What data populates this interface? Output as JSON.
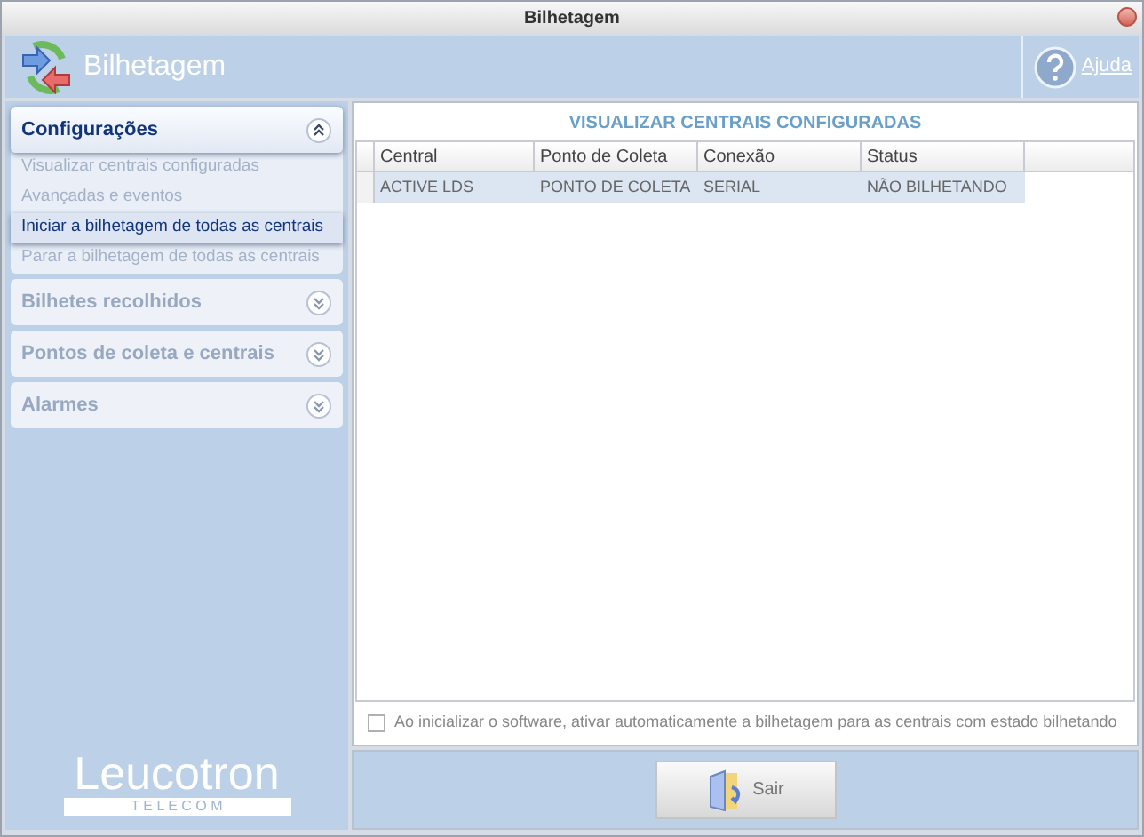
{
  "window": {
    "title": "Bilhetagem"
  },
  "header": {
    "title": "Bilhetagem",
    "help": "Ajuda"
  },
  "sidebar": {
    "sections": [
      {
        "title": "Configurações",
        "expanded": true,
        "items": [
          {
            "label": "Visualizar centrais configuradas",
            "selected": false
          },
          {
            "label": "Avançadas e eventos",
            "selected": false
          },
          {
            "label": "Iniciar a bilhetagem de todas as centrais",
            "selected": true
          },
          {
            "label": "Parar a bilhetagem de todas as centrais",
            "selected": false
          }
        ]
      },
      {
        "title": "Bilhetes recolhidos",
        "expanded": false
      },
      {
        "title": "Pontos de coleta e centrais",
        "expanded": false
      },
      {
        "title": "Alarmes",
        "expanded": false
      }
    ],
    "logo": {
      "name": "Leucotron",
      "tagline": "T E L E C O M"
    }
  },
  "content": {
    "title": "VISUALIZAR CENTRAIS CONFIGURADAS",
    "table": {
      "columns": [
        "Central",
        "Ponto de Coleta",
        "Conexão",
        "Status"
      ],
      "rows": [
        {
          "selected": true,
          "cells": [
            "ACTIVE LDS",
            "PONTO DE COLETA",
            "SERIAL",
            "NÃO BILHETANDO"
          ]
        }
      ]
    },
    "checkbox": {
      "label": "Ao inicializar o software, ativar automaticamente a bilhetagem para as centrais com estado bilhetando",
      "checked": false
    }
  },
  "buttons": [
    {
      "label": "Sair"
    }
  ]
}
